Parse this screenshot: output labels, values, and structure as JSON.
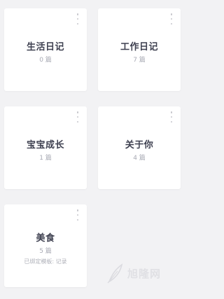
{
  "diaries": [
    {
      "title": "生活日记",
      "count": "0 篇"
    },
    {
      "title": "工作日记",
      "count": "7 篇"
    },
    {
      "title": "宝宝成长",
      "count": "1 篇"
    },
    {
      "title": "关于你",
      "count": "4 篇"
    },
    {
      "title": "美食",
      "count": "5 篇",
      "template": "已绑定模板: 记录"
    }
  ],
  "icons": {
    "card_menu": "more-vertical-icon",
    "watermark_logo": "feather-icon"
  },
  "watermark": {
    "text": "旭隆网"
  },
  "colors": {
    "background": "#f2f2f4",
    "card": "#ffffff",
    "title": "#3e4050",
    "count": "#a7a9b3",
    "menu_dots": "#c6c6cc"
  }
}
